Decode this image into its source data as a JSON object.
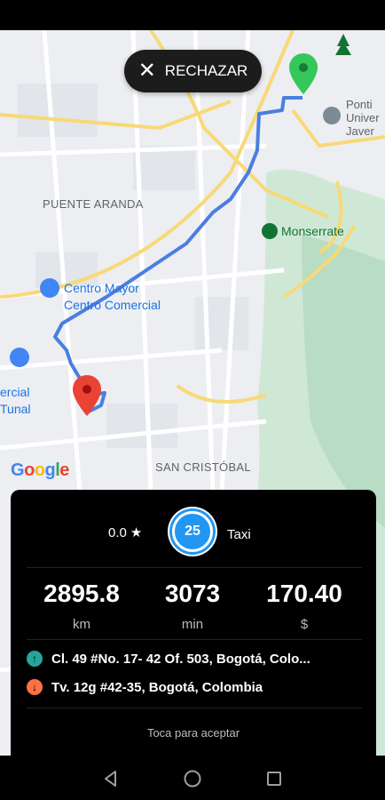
{
  "map": {
    "labels": {
      "puente_aranda": "PUENTE ARANDA",
      "san_cristobal": "SAN CRISTÓBAL",
      "poi_centro_mayor": "Centro Mayor\nCentro Comercial",
      "poi_tunal": "ercial\nTunal",
      "university": "Ponti\nUniver\nJaver",
      "park": "Monserrate",
      "google": "Google"
    }
  },
  "actions": {
    "reject_label": "RECHAZAR"
  },
  "trip": {
    "rating": "0.0",
    "rating_star": "★",
    "timer": "25",
    "service_type": "Taxi",
    "distance": {
      "value": "2895.8",
      "unit": "km"
    },
    "time": {
      "value": "3073",
      "unit": "min"
    },
    "price": {
      "value": "170.40",
      "unit": "$"
    },
    "pickup_address": "Cl. 49 #No. 17- 42 Of. 503, Bogotá, Colo...",
    "dropoff_address": "Tv. 12g #42-35, Bogotá, Colombia",
    "hint": "Toca para aceptar"
  },
  "colors": {
    "route": "#4a7ee0",
    "pickup": "#26a69a",
    "dropoff": "#ff7043",
    "origin_pin": "#34c759",
    "destination_pin": "#ea4335"
  }
}
